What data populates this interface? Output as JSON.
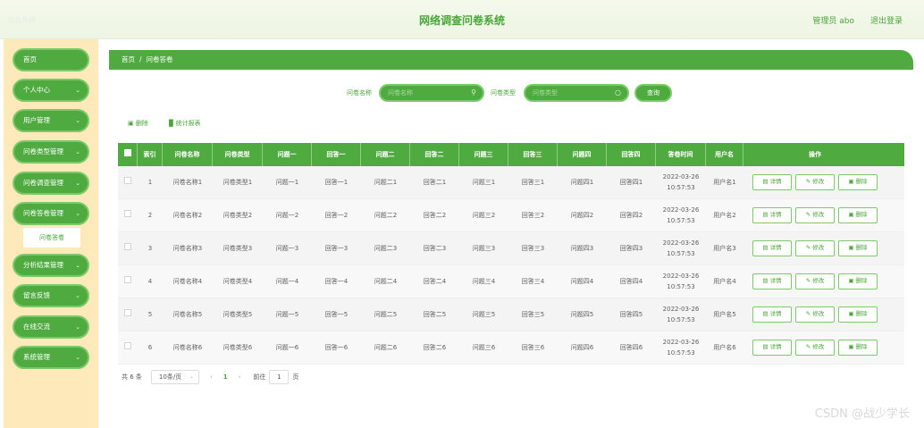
{
  "header": {
    "brand": "后台系统",
    "title": "网络调查问卷系统",
    "admin": "管理员 abo",
    "logout": "退出登录"
  },
  "sidebar": {
    "items": [
      {
        "label": "首页",
        "chevron": ""
      },
      {
        "label": "个人中心",
        "chevron": "⌄"
      },
      {
        "label": "用户管理",
        "chevron": "⌄"
      },
      {
        "label": "问卷类型管理",
        "chevron": "⌄"
      },
      {
        "label": "问卷调查管理",
        "chevron": "⌄"
      },
      {
        "label": "问卷答卷管理",
        "chevron": "⌄"
      },
      {
        "label": "分析结果管理",
        "chevron": "⌄"
      },
      {
        "label": "留言反馈",
        "chevron": "⌄"
      },
      {
        "label": "在线交流",
        "chevron": "⌄"
      },
      {
        "label": "系统管理",
        "chevron": "⌄"
      }
    ],
    "sub_item": "问卷答卷"
  },
  "breadcrumb": {
    "home": "首页",
    "sep": "/",
    "current": "问卷答卷"
  },
  "search": {
    "name_label": "问卷名称",
    "name_placeholder": "问卷名称",
    "type_label": "问卷类型",
    "type_placeholder": "问卷类型",
    "query_button": "查询"
  },
  "actions": {
    "delete": "删除",
    "stats": "统计报表"
  },
  "table": {
    "headers": [
      "",
      "索引",
      "问卷名称",
      "问卷类型",
      "问题一",
      "回答一",
      "问题二",
      "回答二",
      "问题三",
      "回答三",
      "问题四",
      "回答四",
      "答卷时间",
      "用户名",
      "操作"
    ],
    "rows": [
      [
        "1",
        "问卷名称1",
        "问卷类型1",
        "问题一1",
        "回答一1",
        "问题二1",
        "回答二1",
        "问题三1",
        "回答三1",
        "问题四1",
        "回答四1",
        "2022-03-26",
        "10:57:53",
        "用户名1"
      ],
      [
        "2",
        "问卷名称2",
        "问卷类型2",
        "问题一2",
        "回答一2",
        "问题二2",
        "回答二2",
        "问题三2",
        "回答三2",
        "问题四2",
        "回答四2",
        "2022-03-26",
        "10:57:53",
        "用户名2"
      ],
      [
        "3",
        "问卷名称3",
        "问卷类型3",
        "问题一3",
        "回答一3",
        "问题二3",
        "回答二3",
        "问题三3",
        "回答三3",
        "问题四3",
        "回答四3",
        "2022-03-26",
        "10:57:53",
        "用户名3"
      ],
      [
        "4",
        "问卷名称4",
        "问卷类型4",
        "问题一4",
        "回答一4",
        "问题二4",
        "回答二4",
        "问题三4",
        "回答三4",
        "问题四4",
        "回答四4",
        "2022-03-26",
        "10:57:53",
        "用户名4"
      ],
      [
        "5",
        "问卷名称5",
        "问卷类型5",
        "问题一5",
        "回答一5",
        "问题二5",
        "回答二5",
        "问题三5",
        "回答三5",
        "问题四5",
        "回答四5",
        "2022-03-26",
        "10:57:53",
        "用户名5"
      ],
      [
        "6",
        "问卷名称6",
        "问卷类型6",
        "问题一6",
        "回答一6",
        "问题二6",
        "回答二6",
        "问题三6",
        "回答三6",
        "问题四6",
        "回答四6",
        "2022-03-26",
        "10:57:53",
        "用户名6"
      ]
    ],
    "row_buttons": {
      "detail": "详情",
      "edit": "修改",
      "delete": "删除"
    }
  },
  "pagination": {
    "total": "共 6 条",
    "page_size": "10条/页",
    "prev": "‹",
    "current": "1",
    "next": "›",
    "goto_label": "前往",
    "goto_value": "1",
    "goto_suffix": "页"
  },
  "watermark": "CSDN @战少学长",
  "colors": {
    "primary": "#4fab3f",
    "sidebar_bg": "#fde9b9",
    "accent_text": "#4aa53a"
  }
}
